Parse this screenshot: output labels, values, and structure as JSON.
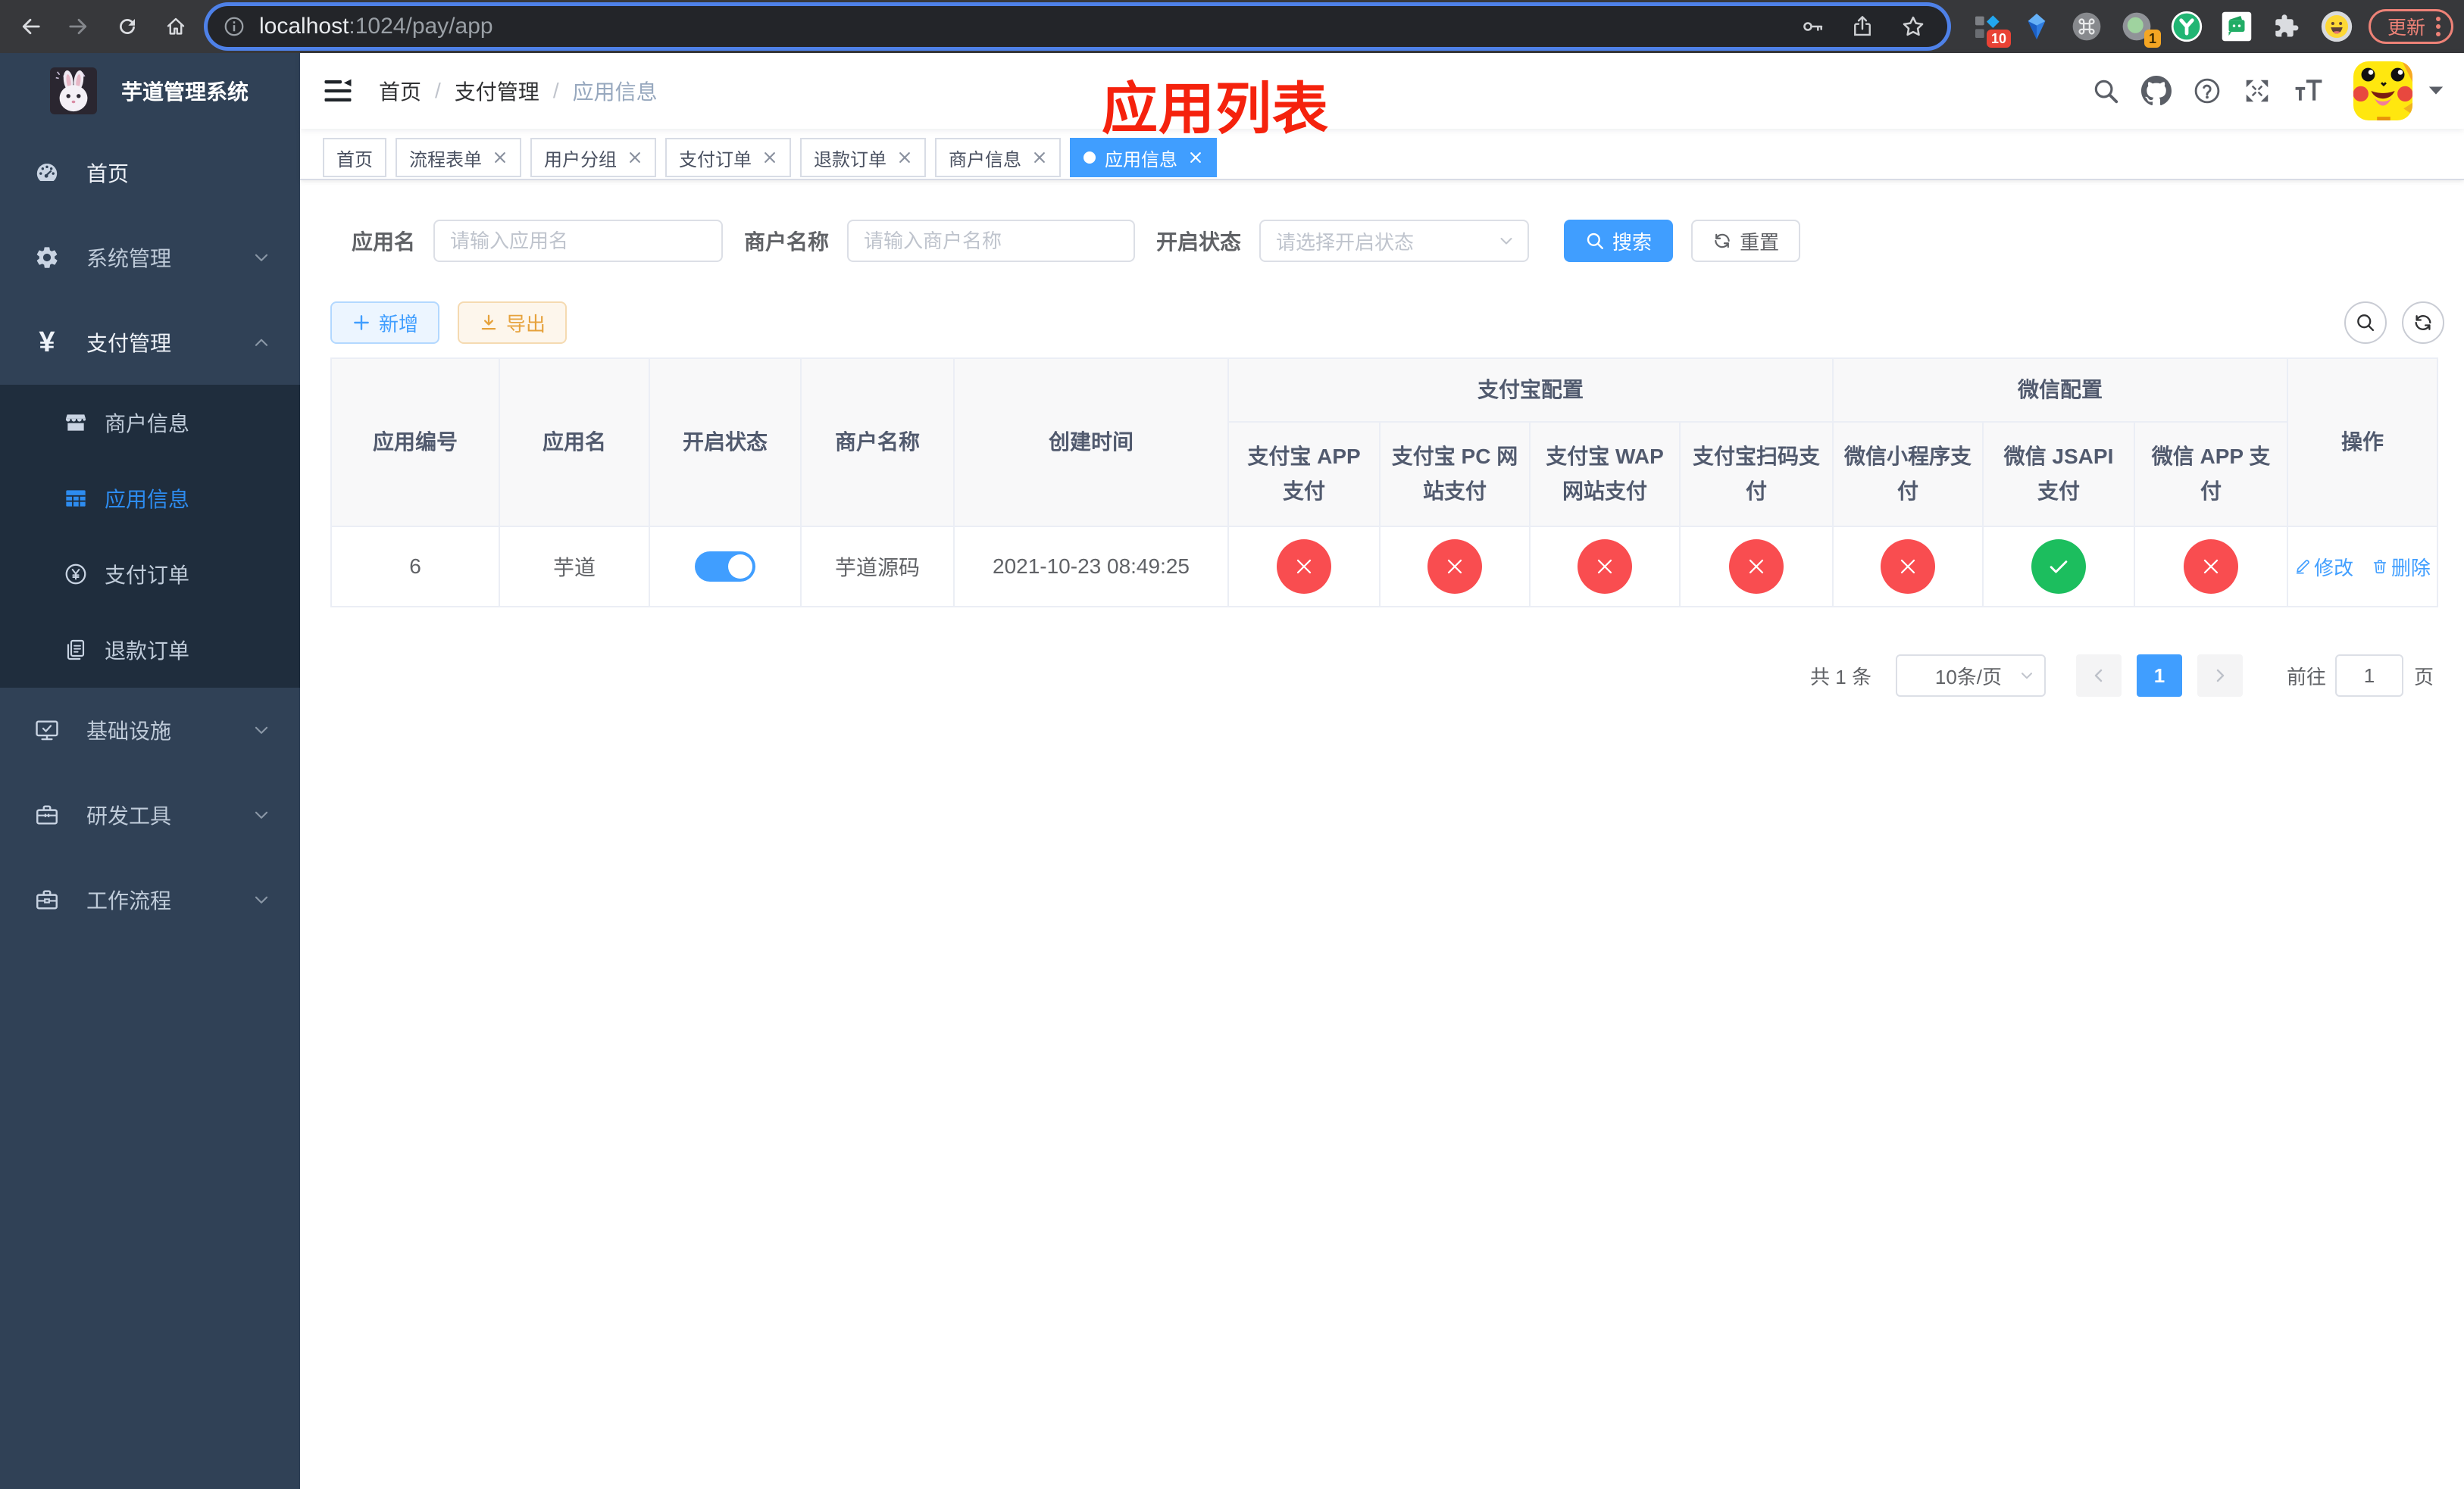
{
  "browser": {
    "url_host": "localhost",
    "url_path": ":1024/pay/app",
    "extension_badge_count": "10",
    "notification_badge_count": "1",
    "update_button_label": "更新"
  },
  "annotation": {
    "text": "应用列表",
    "color": "#f5220d"
  },
  "sidebar": {
    "logo_title": "芋道管理系统",
    "items": [
      {
        "label": "首页"
      },
      {
        "label": "系统管理"
      },
      {
        "label": "支付管理"
      },
      {
        "label": "基础设施"
      },
      {
        "label": "研发工具"
      },
      {
        "label": "工作流程"
      }
    ],
    "pay_children": [
      {
        "label": "商户信息"
      },
      {
        "label": "应用信息",
        "active": true
      },
      {
        "label": "支付订单"
      },
      {
        "label": "退款订单"
      }
    ]
  },
  "navbar": {
    "breadcrumb": [
      "首页",
      "支付管理",
      "应用信息"
    ]
  },
  "tags": [
    {
      "label": "首页"
    },
    {
      "label": "流程表单"
    },
    {
      "label": "用户分组"
    },
    {
      "label": "支付订单"
    },
    {
      "label": "退款订单"
    },
    {
      "label": "商户信息"
    },
    {
      "label": "应用信息"
    }
  ],
  "filters": {
    "app_name_label": "应用名",
    "app_name_placeholder": "请输入应用名",
    "merchant_label": "商户名称",
    "merchant_placeholder": "请输入商户名称",
    "status_label": "开启状态",
    "status_placeholder": "请选择开启状态",
    "search_label": "搜索",
    "reset_label": "重置"
  },
  "toolbar": {
    "add_label": "新增",
    "export_label": "导出"
  },
  "table": {
    "col_app_id": "应用编号",
    "col_app_name": "应用名",
    "col_status": "开启状态",
    "col_merchant": "商户名称",
    "col_created": "创建时间",
    "group_alipay": "支付宝配置",
    "group_wechat": "微信配置",
    "col_alipay_app": "支付宝 APP 支付",
    "col_alipay_pc": "支付宝 PC 网站支付",
    "col_alipay_wap": "支付宝 WAP 网站支付",
    "col_alipay_qr": "支付宝扫码支付",
    "col_wx_lite": "微信小程序支付",
    "col_wx_jsapi": "微信 JSAPI 支付",
    "col_wx_app": "微信 APP 支付",
    "col_op": "操作",
    "row": {
      "app_id": "6",
      "app_name": "芋道",
      "status_on": true,
      "merchant": "芋道源码",
      "created_at": "2021-10-23 08:49:25",
      "alipay_app": false,
      "alipay_pc": false,
      "alipay_wap": false,
      "alipay_qr": false,
      "wx_lite": false,
      "wx_jsapi": true,
      "wx_app": false,
      "edit_label": "修改",
      "delete_label": "删除"
    }
  },
  "pagination": {
    "total_label": "共 1 条",
    "page_size_label": "10条/页",
    "current_page": "1",
    "goto_label": "前往",
    "goto_value": "1",
    "page_unit_label": "页"
  }
}
